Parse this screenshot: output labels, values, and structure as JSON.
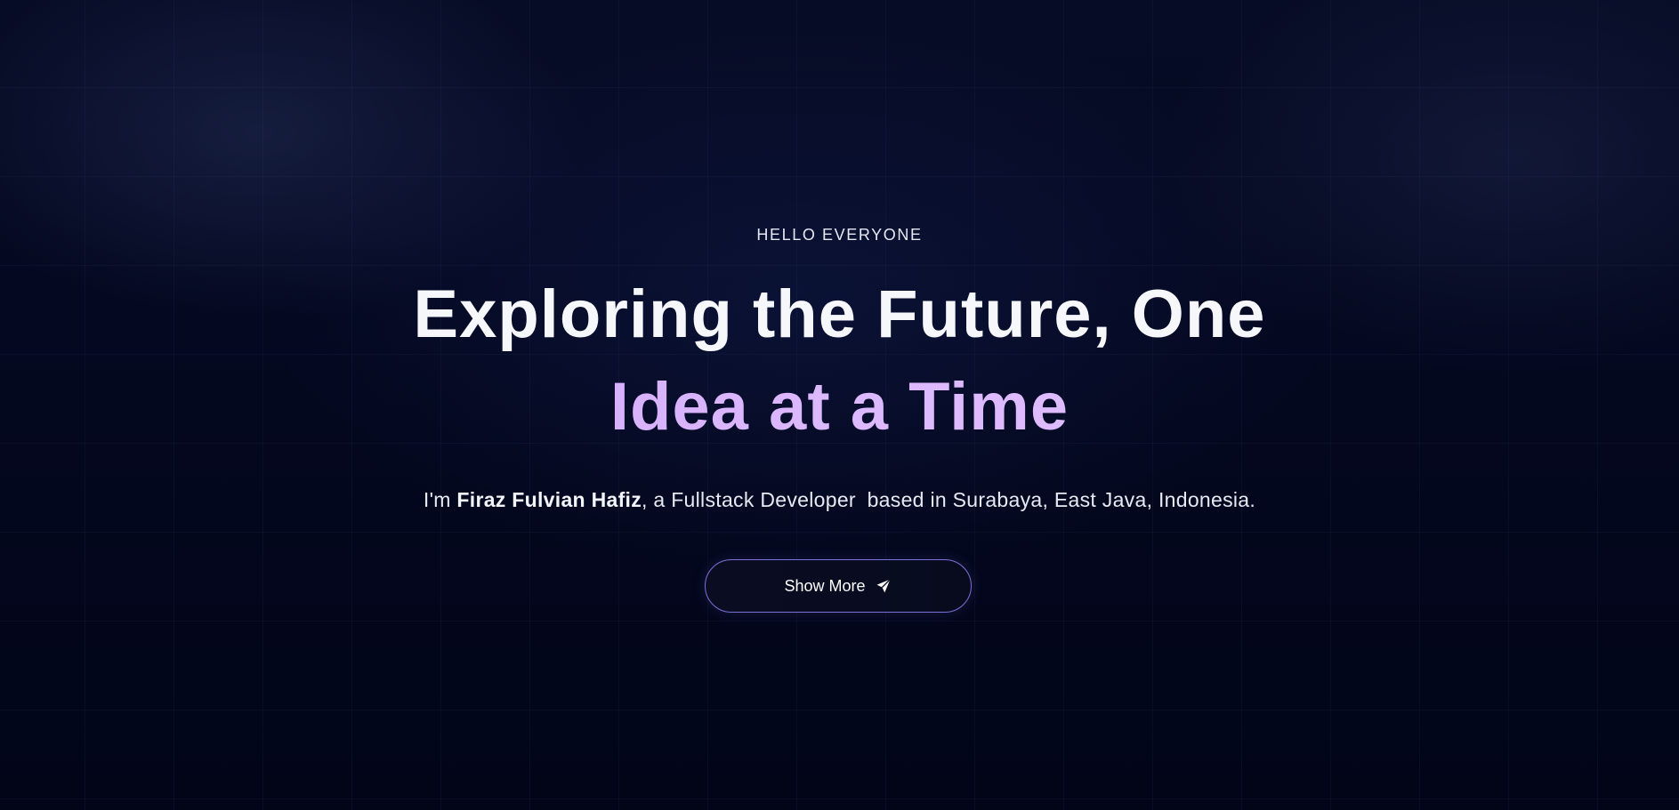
{
  "hero": {
    "eyebrow": "HELLO EVERYONE",
    "headline_line1": "Exploring the Future, One",
    "headline_line2": "Idea at a Time",
    "intro_prefix": "I'm ",
    "intro_name": "Firaz Fulvian Hafiz",
    "intro_role": ", a Fullstack Developer",
    "intro_location": "based in Surabaya, East Java, Indonesia.",
    "cta_label": "Show More",
    "cta_icon": "send-icon"
  },
  "colors": {
    "background": "#03061a",
    "headline": "#f6f7fb",
    "accent": "#d8b4fe",
    "cta_border": "#7c6fd6"
  }
}
